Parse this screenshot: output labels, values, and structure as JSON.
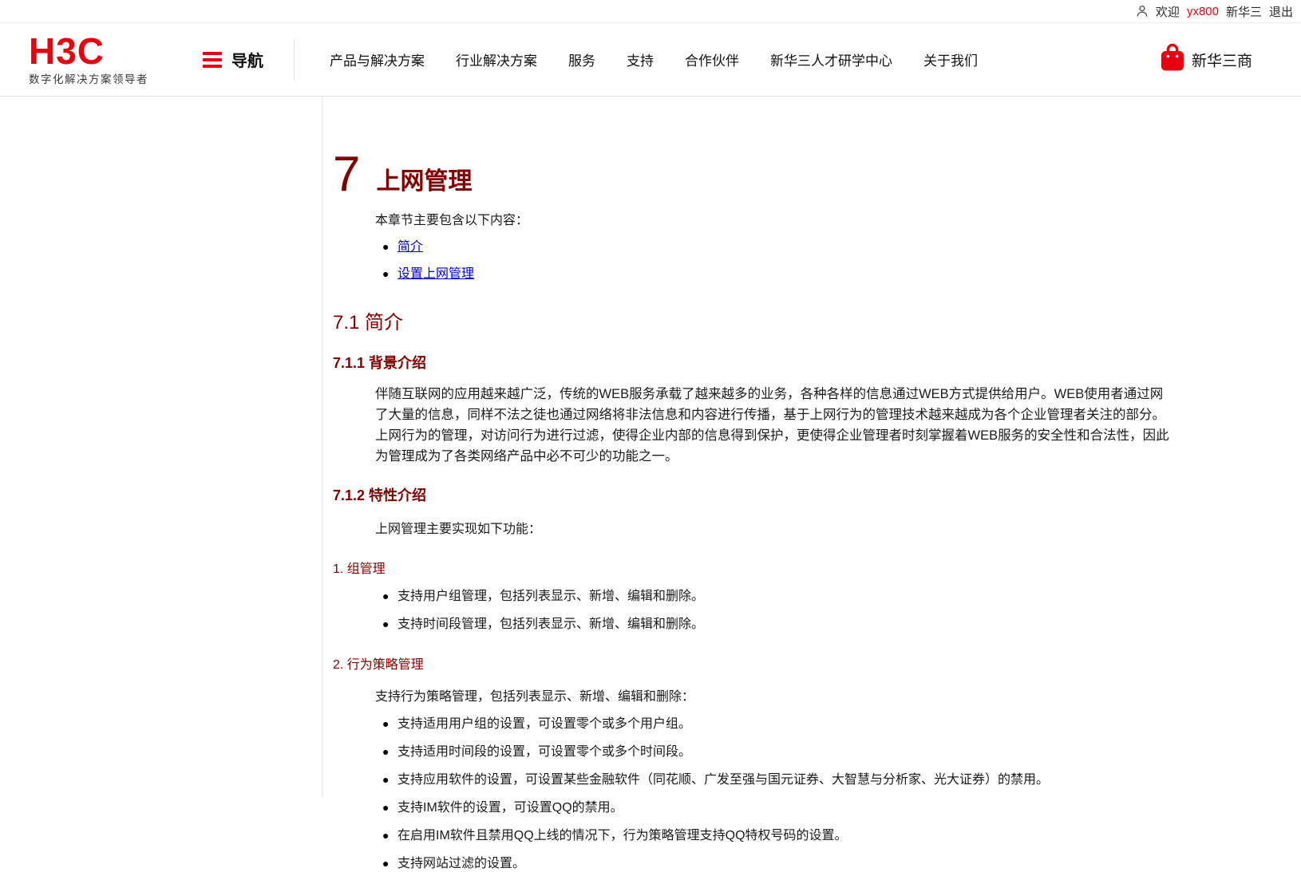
{
  "colors": {
    "brand_red": "#e60012",
    "heading_maroon": "#800000",
    "link_blue": "#0000cc"
  },
  "topbar": {
    "welcome": "欢迎",
    "username": "yx800",
    "company": "新华三",
    "logout": "退出"
  },
  "header": {
    "logo": "H3C",
    "tagline": "数字化解决方案领导者",
    "nav_toggle": "导航",
    "nav_items": [
      "产品与解决方案",
      "行业解决方案",
      "服务",
      "支持",
      "合作伙伴",
      "新华三人才研学中心",
      "关于我们"
    ],
    "store": "新华三商"
  },
  "content": {
    "chapter_number": "7",
    "chapter_title": "上网管理",
    "intro": "本章节主要包含以下内容：",
    "toc": [
      "简介",
      "设置上网管理"
    ],
    "s71": "7.1 简介",
    "s711": "7.1.1 背景介绍",
    "para": [
      "伴随互联网的应用越来越广泛，传统的WEB服务承载了越来越多的业务，各种各样的信息通过WEB方式提供给用户。WEB使用者通过网",
      "了大量的信息，同样不法之徒也通过网络将非法信息和内容进行传播，基于上网行为的管理技术越来越成为各个企业管理者关注的部分。",
      "上网行为的管理，对访问行为进行过滤，使得企业内部的信息得到保护，更使得企业管理者时刻掌握着WEB服务的安全性和合法性，因此",
      "为管理成为了各类网络产品中必不可少的功能之一。"
    ],
    "s712": "7.1.2 特性介绍",
    "features_intro": "上网管理主要实现如下功能：",
    "group": {
      "heading": "1. 组管理",
      "bullets": [
        "支持用户组管理，包括列表显示、新增、编辑和删除。",
        "支持时间段管理，包括列表显示、新增、编辑和删除。"
      ]
    },
    "policy": {
      "heading": "2. 行为策略管理",
      "intro": "支持行为策略管理，包括列表显示、新增、编辑和删除：",
      "bullets": [
        "支持适用用户组的设置，可设置零个或多个用户组。",
        "支持适用时间段的设置，可设置零个或多个时间段。",
        "支持应用软件的设置，可设置某些金融软件（同花顺、广发至强与国元证券、大智慧与分析家、光大证券）的禁用。",
        "支持IM软件的设置，可设置QQ的禁用。",
        "在启用IM软件且禁用QQ上线的情况下，行为策略管理支持QQ特权号码的设置。",
        "支持网站过滤的设置。"
      ]
    }
  }
}
